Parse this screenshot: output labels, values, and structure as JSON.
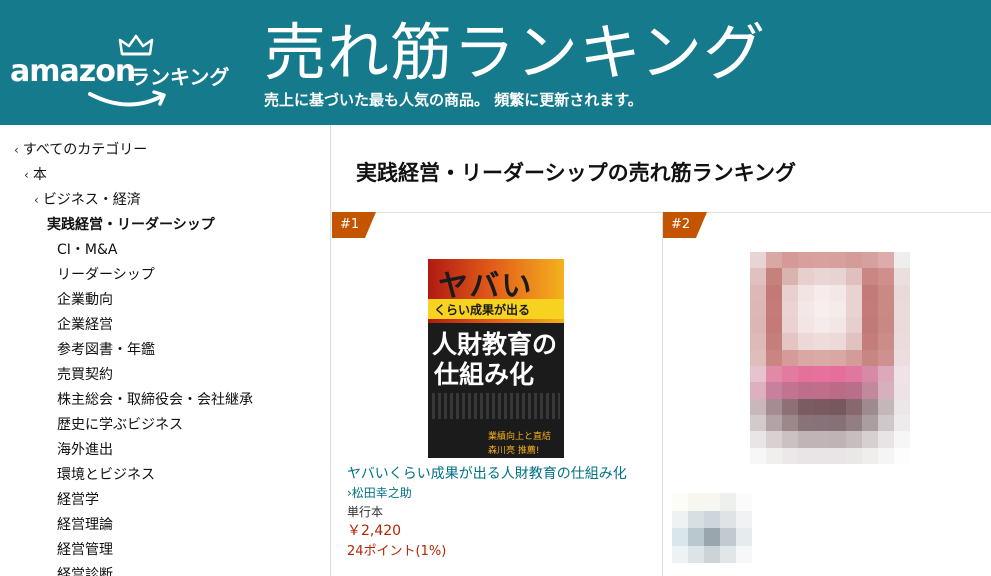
{
  "banner": {
    "logo_word": "amazon",
    "logo_sub": "ランキング",
    "title": "売れ筋ランキング",
    "subtitle": "売上に基づいた最も人気の商品。 頻繁に更新されます。",
    "bg_color": "#157a8c"
  },
  "sidebar": {
    "items": [
      {
        "label": "すべてのカテゴリー",
        "chevron": "‹"
      },
      {
        "label": "本",
        "chevron": "‹"
      },
      {
        "label": "ビジネス・経済",
        "chevron": "‹"
      },
      {
        "label": "実践経営・リーダーシップ"
      },
      {
        "label": "CI・M&A"
      },
      {
        "label": "リーダーシップ"
      },
      {
        "label": "企業動向"
      },
      {
        "label": "企業経営"
      },
      {
        "label": "参考図書・年鑑"
      },
      {
        "label": "売買契約"
      },
      {
        "label": "株主総会・取締役会・会社継承"
      },
      {
        "label": "歴史に学ぶビジネス"
      },
      {
        "label": "海外進出"
      },
      {
        "label": "環境とビジネス"
      },
      {
        "label": "経営学"
      },
      {
        "label": "経営理論"
      },
      {
        "label": "経営管理"
      },
      {
        "label": "経営診断"
      }
    ]
  },
  "main": {
    "title": "実践経営・リーダーシップの売れ筋ランキング",
    "products": [
      {
        "rank": "#1",
        "cover": {
          "line1": "ヤバい",
          "line2": "くらい成果が出る",
          "line3": "人財教育の",
          "line4": "仕組み化",
          "blurb1": "業績向上と直結",
          "blurb2": "森川亮 推薦!"
        },
        "title": "ヤバいくらい成果が出る人財教育の仕組み化",
        "author": "›松田幸之助",
        "format": "単行本",
        "price": "￥2,420",
        "points": "24ポイント(1%)"
      },
      {
        "rank": "#2"
      }
    ]
  },
  "colors": {
    "badge": "#c45500",
    "link": "#007185",
    "price": "#b12704"
  }
}
